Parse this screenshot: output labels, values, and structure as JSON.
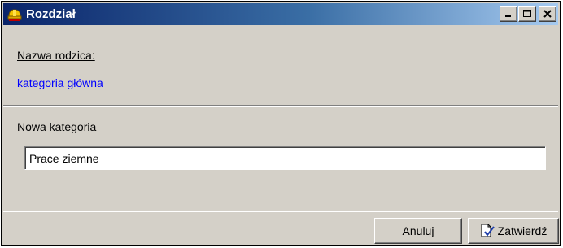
{
  "window": {
    "title": "Rozdział",
    "icon": "helmet-icon"
  },
  "parent": {
    "label": "Nazwa rodzica:",
    "value": "kategoria główna"
  },
  "new_category": {
    "label": "Nowa kategoria",
    "value": "Prace ziemne"
  },
  "buttons": {
    "cancel_label": "Anuluj",
    "confirm_label": "Zatwierdź",
    "confirm_icon": "document-check-icon"
  },
  "colors": {
    "title_gradient_start": "#0a246a",
    "title_gradient_end": "#a6caf0",
    "parent_value_color": "#0000ff",
    "dialog_background": "#d4d0c8"
  }
}
